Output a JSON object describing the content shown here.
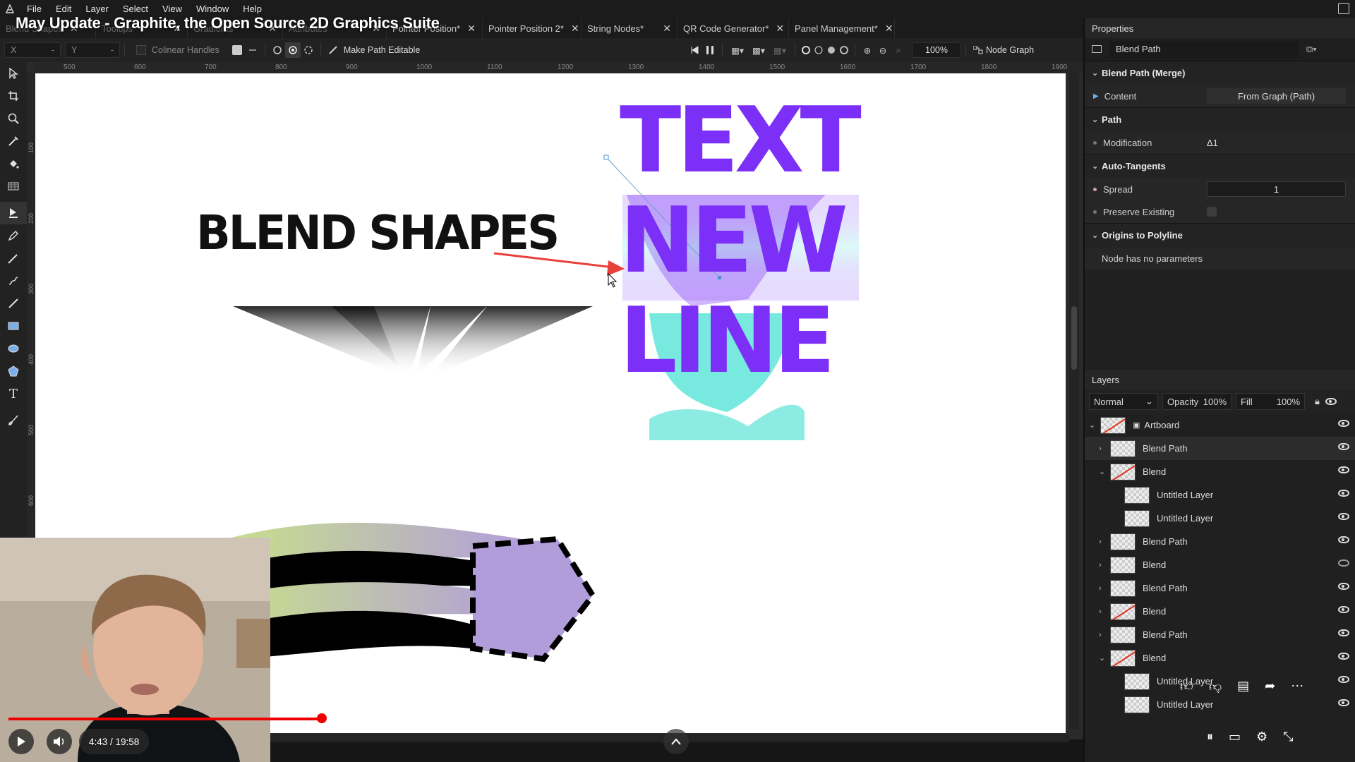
{
  "menubar": {
    "items": [
      "File",
      "Edit",
      "Layer",
      "Select",
      "View",
      "Window",
      "Help"
    ]
  },
  "video_title": "May Update - Graphite, the Open Source 2D Graphics Suite",
  "tabs": [
    {
      "label": "Blend Shapes",
      "faded": true
    },
    {
      "label": "Tooltips",
      "faded": true
    },
    {
      "label": "Gradients",
      "faded": true
    },
    {
      "label": "Attributes",
      "faded": true
    },
    {
      "label": "Pointer Position*",
      "faded": false
    },
    {
      "label": "Pointer Position 2*",
      "faded": false
    },
    {
      "label": "String Nodes*",
      "faded": false
    },
    {
      "label": "QR Code Generator*",
      "faded": false
    },
    {
      "label": "Panel Management*",
      "faded": false
    }
  ],
  "options": {
    "x_label": "X",
    "y_label": "Y",
    "colinear_label": "Colinear Handles",
    "make_editable_label": "Make Path Editable",
    "zoom": "100%",
    "node_graph_label": "Node Graph"
  },
  "ruler": {
    "ticks": [
      "500",
      "600",
      "700",
      "800",
      "900",
      "1000",
      "1100",
      "1200",
      "1300",
      "1400",
      "1500",
      "1600",
      "1700",
      "1800",
      "1900"
    ],
    "left_ticks": [
      "100",
      "200",
      "300",
      "400",
      "500",
      "600"
    ]
  },
  "canvas": {
    "blend_shapes_text": "BLEND SHAPES",
    "text_lines": [
      "TEXT",
      "NEW",
      "LINE"
    ],
    "colors": {
      "purple": "#7b2ff7",
      "cyan": "#3fe0d0",
      "arrow": "#e8403a",
      "lavender": "#b29ddb",
      "lime": "#c8e08a"
    }
  },
  "properties": {
    "header": "Properties",
    "node_name": "Blend Path",
    "sections": [
      {
        "title": "Blend Path (Merge)",
        "rows": [
          {
            "label": "Content",
            "value": "From Graph (Path)"
          }
        ]
      },
      {
        "title": "Path",
        "rows": [
          {
            "label": "Modification",
            "value": "Δ1"
          }
        ]
      },
      {
        "title": "Auto-Tangents",
        "rows": [
          {
            "label": "Spread",
            "value": "1"
          },
          {
            "label": "Preserve Existing",
            "value": ""
          }
        ]
      },
      {
        "title": "Origins to Polyline",
        "rows": [
          {
            "label": "Node has no parameters",
            "value": ""
          }
        ]
      }
    ]
  },
  "layers": {
    "header": "Layers",
    "blend_mode": "Normal",
    "opacity_label": "Opacity",
    "opacity_value": "100%",
    "fill_label": "Fill",
    "fill_value": "100%",
    "items": [
      {
        "name": "Artboard",
        "depth": 0,
        "expanded": true,
        "slash": true,
        "visible": true
      },
      {
        "name": "Blend Path",
        "depth": 1,
        "expanded": false,
        "slash": false,
        "visible": true
      },
      {
        "name": "Blend",
        "depth": 1,
        "expanded": true,
        "slash": true,
        "visible": true
      },
      {
        "name": "Untitled Layer",
        "depth": 2,
        "expanded": null,
        "slash": false,
        "visible": true
      },
      {
        "name": "Untitled Layer",
        "depth": 2,
        "expanded": null,
        "slash": false,
        "visible": true
      },
      {
        "name": "Blend Path",
        "depth": 1,
        "expanded": false,
        "slash": false,
        "visible": true
      },
      {
        "name": "Blend",
        "depth": 1,
        "expanded": false,
        "slash": false,
        "visible": false
      },
      {
        "name": "Blend Path",
        "depth": 1,
        "expanded": false,
        "slash": false,
        "visible": true
      },
      {
        "name": "Blend",
        "depth": 1,
        "expanded": false,
        "slash": true,
        "visible": true
      },
      {
        "name": "Blend Path",
        "depth": 1,
        "expanded": false,
        "slash": false,
        "visible": true
      },
      {
        "name": "Blend",
        "depth": 1,
        "expanded": true,
        "slash": true,
        "visible": true
      },
      {
        "name": "Untitled Layer",
        "depth": 2,
        "expanded": null,
        "slash": false,
        "visible": true
      },
      {
        "name": "Untitled Layer",
        "depth": 2,
        "expanded": null,
        "slash": false,
        "visible": true
      }
    ]
  },
  "video": {
    "time": "4:43 / 19:58",
    "progress_fraction": 0.236
  }
}
